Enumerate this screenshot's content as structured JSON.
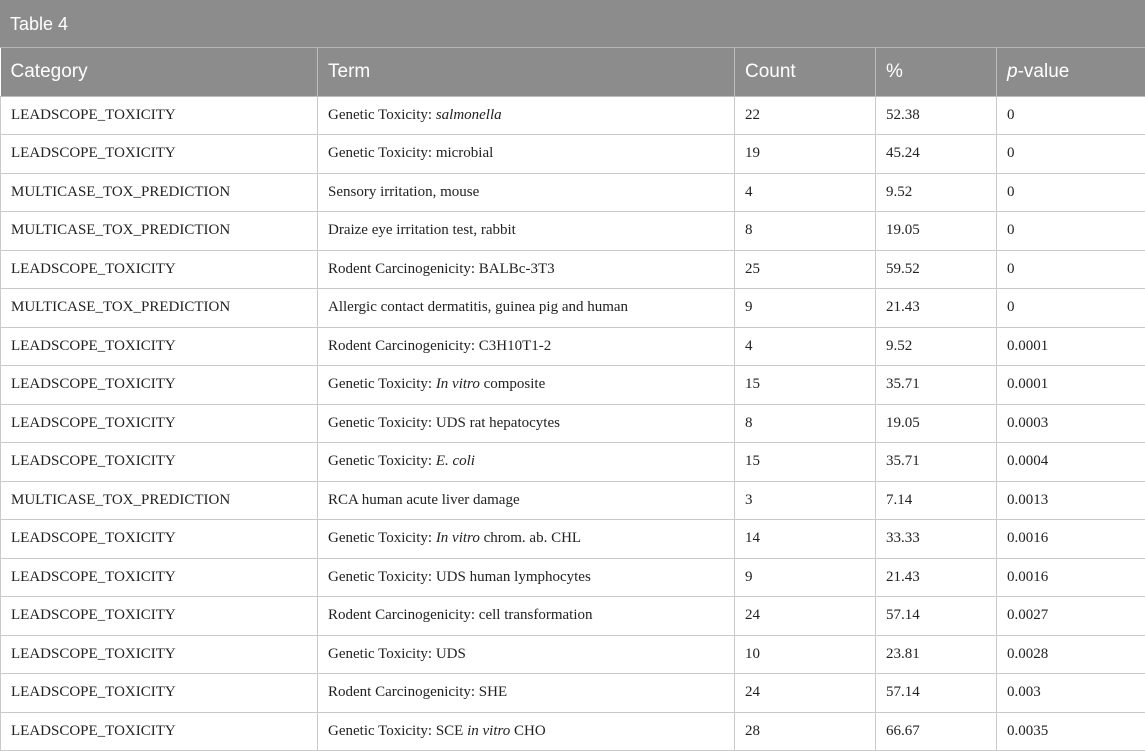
{
  "caption": "Table 4",
  "headers": {
    "category": "Category",
    "term": "Term",
    "count": "Count",
    "percent": "%",
    "pvalue_italic": "p",
    "pvalue_rest": "-value"
  },
  "rows": [
    {
      "category": "LEADSCOPE_TOXICITY",
      "term_pre": "Genetic Toxicity: ",
      "term_it": "salmonella",
      "term_post": "",
      "count": "22",
      "percent": "52.38",
      "pvalue": "0"
    },
    {
      "category": "LEADSCOPE_TOXICITY",
      "term_pre": "Genetic Toxicity: microbial",
      "term_it": "",
      "term_post": "",
      "count": "19",
      "percent": "45.24",
      "pvalue": "0"
    },
    {
      "category": "MULTICASE_TOX_PREDICTION",
      "term_pre": "Sensory irritation, mouse",
      "term_it": "",
      "term_post": "",
      "count": "4",
      "percent": "9.52",
      "pvalue": "0"
    },
    {
      "category": "MULTICASE_TOX_PREDICTION",
      "term_pre": "Draize eye irritation test, rabbit",
      "term_it": "",
      "term_post": "",
      "count": "8",
      "percent": "19.05",
      "pvalue": "0"
    },
    {
      "category": "LEADSCOPE_TOXICITY",
      "term_pre": "Rodent Carcinogenicity: BALBc-3T3",
      "term_it": "",
      "term_post": "",
      "count": "25",
      "percent": "59.52",
      "pvalue": "0"
    },
    {
      "category": "MULTICASE_TOX_PREDICTION",
      "term_pre": "Allergic contact dermatitis, guinea pig and human",
      "term_it": "",
      "term_post": "",
      "count": "9",
      "percent": "21.43",
      "pvalue": "0"
    },
    {
      "category": "LEADSCOPE_TOXICITY",
      "term_pre": "Rodent Carcinogenicity: C3H10T1-2",
      "term_it": "",
      "term_post": "",
      "count": "4",
      "percent": "9.52",
      "pvalue": "0.0001"
    },
    {
      "category": "LEADSCOPE_TOXICITY",
      "term_pre": "Genetic Toxicity: ",
      "term_it": "In vitro",
      "term_post": " composite",
      "count": "15",
      "percent": "35.71",
      "pvalue": "0.0001"
    },
    {
      "category": "LEADSCOPE_TOXICITY",
      "term_pre": "Genetic Toxicity: UDS rat hepatocytes",
      "term_it": "",
      "term_post": "",
      "count": "8",
      "percent": "19.05",
      "pvalue": "0.0003"
    },
    {
      "category": "LEADSCOPE_TOXICITY",
      "term_pre": "Genetic Toxicity: ",
      "term_it": "E. coli",
      "term_post": "",
      "count": "15",
      "percent": "35.71",
      "pvalue": "0.0004"
    },
    {
      "category": "MULTICASE_TOX_PREDICTION",
      "term_pre": "RCA human acute liver damage",
      "term_it": "",
      "term_post": "",
      "count": "3",
      "percent": "7.14",
      "pvalue": "0.0013"
    },
    {
      "category": "LEADSCOPE_TOXICITY",
      "term_pre": "Genetic Toxicity: ",
      "term_it": "In vitro",
      "term_post": " chrom. ab. CHL",
      "count": "14",
      "percent": "33.33",
      "pvalue": "0.0016"
    },
    {
      "category": "LEADSCOPE_TOXICITY",
      "term_pre": "Genetic Toxicity: UDS human lymphocytes",
      "term_it": "",
      "term_post": "",
      "count": "9",
      "percent": "21.43",
      "pvalue": "0.0016"
    },
    {
      "category": "LEADSCOPE_TOXICITY",
      "term_pre": "Rodent Carcinogenicity: cell transformation",
      "term_it": "",
      "term_post": "",
      "count": "24",
      "percent": "57.14",
      "pvalue": "0.0027"
    },
    {
      "category": "LEADSCOPE_TOXICITY",
      "term_pre": "Genetic Toxicity: UDS",
      "term_it": "",
      "term_post": "",
      "count": "10",
      "percent": "23.81",
      "pvalue": "0.0028"
    },
    {
      "category": "LEADSCOPE_TOXICITY",
      "term_pre": "Rodent Carcinogenicity: SHE",
      "term_it": "",
      "term_post": "",
      "count": "24",
      "percent": "57.14",
      "pvalue": "0.003"
    },
    {
      "category": "LEADSCOPE_TOXICITY",
      "term_pre": "Genetic Toxicity: SCE ",
      "term_it": "in vitro",
      "term_post": " CHO",
      "count": "28",
      "percent": "66.67",
      "pvalue": "0.0035"
    }
  ]
}
